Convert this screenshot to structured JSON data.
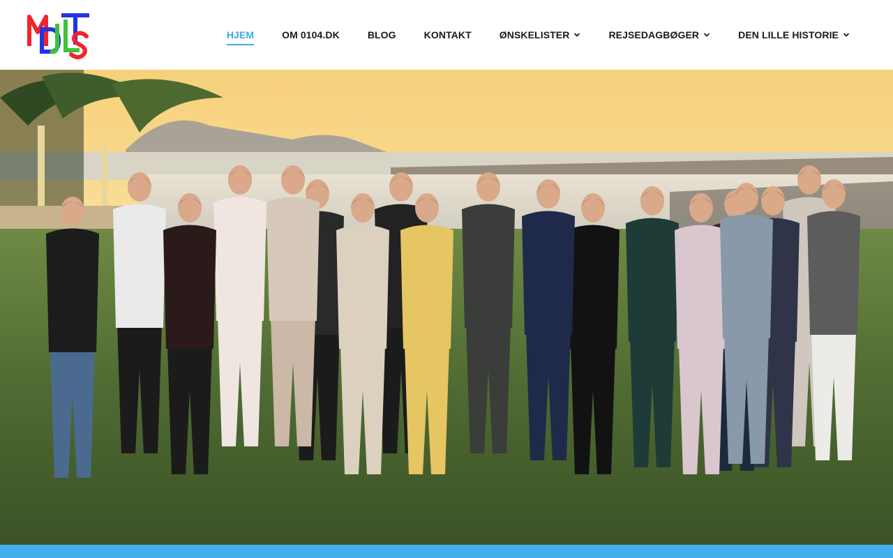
{
  "site": {
    "logo_name": "site-logo",
    "logo_letters": [
      "M",
      "D",
      "J",
      "L",
      "T",
      "S"
    ]
  },
  "nav": {
    "items": [
      {
        "label": "HJEM",
        "active": true,
        "dropdown": false
      },
      {
        "label": "OM 0104.DK",
        "active": false,
        "dropdown": false
      },
      {
        "label": "BLOG",
        "active": false,
        "dropdown": false
      },
      {
        "label": "KONTAKT",
        "active": false,
        "dropdown": false
      },
      {
        "label": "ØNSKELISTER",
        "active": false,
        "dropdown": true
      },
      {
        "label": "REJSEDAGBØGER",
        "active": false,
        "dropdown": true
      },
      {
        "label": "DEN LILLE HISTORIE",
        "active": false,
        "dropdown": true
      }
    ]
  },
  "hero": {
    "image": "family-group-photo-sunset",
    "people_count": 19
  },
  "colors": {
    "accent": "#3fa9e8",
    "bottom_bar": "#45aeee",
    "nav_text": "#1a1a1a",
    "logo_red": "#f0252a",
    "logo_blue": "#2433e6",
    "logo_green": "#3cc43a"
  }
}
